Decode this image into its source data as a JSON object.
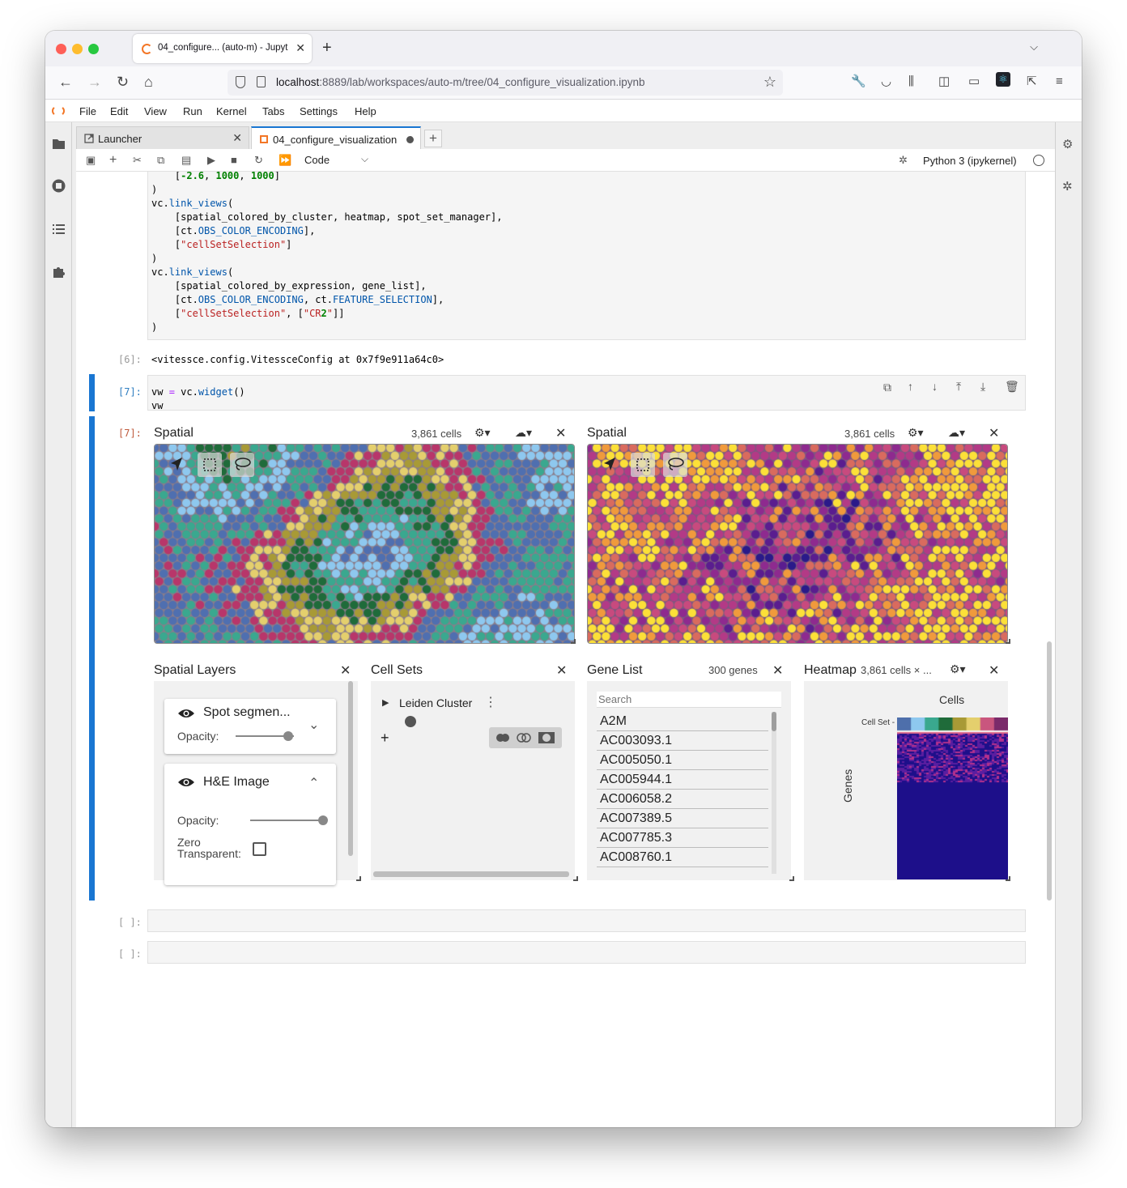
{
  "browser": {
    "tab_title": "04_configure... (auto-m) - Jupyt",
    "url_host": "localhost",
    "url_path": ":8889/lab/workspaces/auto-m/tree/04_configure_visualization.ipynb"
  },
  "menu": [
    "File",
    "Edit",
    "View",
    "Run",
    "Kernel",
    "Tabs",
    "Settings",
    "Help"
  ],
  "doc_tabs": [
    {
      "label": "Launcher",
      "active": false
    },
    {
      "label": "04_configure_visualization",
      "active": true,
      "unsaved": true
    }
  ],
  "toolbar": {
    "cell_type": "Code",
    "kernel": "Python 3 (ipykernel)"
  },
  "cells": {
    "cell6_code_lines": [
      "    [-2.6, 1000, 1000]",
      ")",
      "vc.link_views(",
      "    [spatial_colored_by_cluster, heatmap, spot_set_manager],",
      "    [ct.OBS_COLOR_ENCODING],",
      "    [\"cellSetSelection\"]",
      ")",
      "vc.link_views(",
      "    [spatial_colored_by_expression, gene_list],",
      "    [ct.OBS_COLOR_ENCODING, ct.FEATURE_SELECTION],",
      "    [\"cellSetSelection\", [\"CR2\"]]",
      ")"
    ],
    "cell6_out_prompt": "[6]:",
    "cell6_output": "<vitessce.config.VitessceConfig at 0x7f9e911a64c0>",
    "cell7_in_prompt": "[7]:",
    "cell7_code_lines": [
      "vw = vc.widget()",
      "vw"
    ],
    "cell7_out_prompt": "[7]:",
    "empty_prompt": "[ ]:"
  },
  "vitessce": {
    "spatial1": {
      "title": "Spatial",
      "count": "3,861 cells"
    },
    "spatial2": {
      "title": "Spatial",
      "count": "3,861 cells"
    },
    "layers": {
      "title": "Spatial Layers",
      "spot_layer": "Spot segmen...",
      "opacity_label": "Opacity:",
      "image_layer": "H&E Image",
      "zero_transparent": "Zero Transparent:",
      "spot_opacity": 0.9,
      "image_opacity": 1.0
    },
    "cell_sets": {
      "title": "Cell Sets",
      "item": "Leiden Cluster"
    },
    "gene_list": {
      "title": "Gene List",
      "count": "300 genes",
      "search_placeholder": "Search",
      "genes": [
        "A2M",
        "AC003093.1",
        "AC005050.1",
        "AC005944.1",
        "AC006058.2",
        "AC007389.5",
        "AC007785.3",
        "AC008760.1"
      ]
    },
    "heatmap": {
      "title": "Heatmap",
      "meta": "3,861 cells × ...",
      "x_label": "Cells",
      "y_label": "Genes",
      "row_label": "Cell Set -"
    }
  },
  "colors": {
    "accent": "#1976d2",
    "jupyter_orange": "#f37626"
  }
}
